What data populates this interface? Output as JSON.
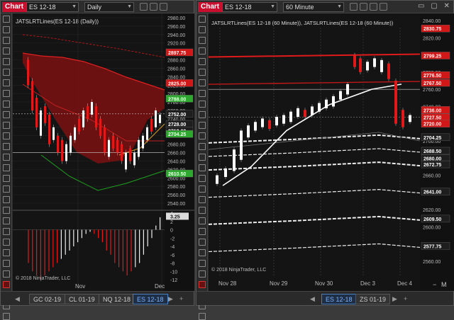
{
  "left": {
    "chart_label": "Chart",
    "instrument": "ES 12-18",
    "interval": "Daily",
    "plot_title": "JATSLRTLines(ES 12-18 (Daily))",
    "copyright": "© 2018 NinjaTrader, LLC",
    "price_ticks": [
      "2980.00",
      "2960.00",
      "2940.00",
      "2920.00",
      "2900.00",
      "2880.00",
      "2860.00",
      "2840.00",
      "2820.00",
      "2800.00",
      "2780.00",
      "2760.00",
      "2740.00",
      "2720.00",
      "2700.00",
      "2680.00",
      "2660.00",
      "2640.00",
      "2620.00",
      "2600.00",
      "2580.00",
      "2560.00",
      "2540.00"
    ],
    "price_badges": [
      {
        "text": "2897.75",
        "color": "#d01818"
      },
      {
        "text": "2825.00",
        "color": "#d01818"
      },
      {
        "text": "2788.00",
        "color": "#2ea82e"
      },
      {
        "text": "2752.00",
        "color": "#1e1e1e"
      },
      {
        "text": "2728.00",
        "color": "#1e1e1e"
      },
      {
        "text": "2712.00",
        "color": "#1e1e1e"
      },
      {
        "text": "2704.25",
        "color": "#2ea82e"
      },
      {
        "text": "2610.50",
        "color": "#2ea82e"
      }
    ],
    "osc_badge": "3.25",
    "osc_ticks": [
      "4",
      "2",
      "0",
      "-2",
      "-4",
      "-6",
      "-8",
      "-10",
      "-12"
    ],
    "x_labels": [
      "Nov",
      "Dec"
    ],
    "tabs": [
      "GC 02-19",
      "CL 01-19",
      "NQ 12-18",
      "ES 12-18"
    ],
    "active_tab": "ES 12-18"
  },
  "right": {
    "chart_label": "Chart",
    "instrument": "ES 12-18",
    "interval": "60 Minute",
    "plot_title": "JATSLRTLines(ES 12-18 (60 Minute)), JATSLRTLines(ES 12-18 (60 Minute))",
    "copyright": "© 2018 NinjaTrader, LLC",
    "price_ticks": [
      "2840.00",
      "2820.00",
      "2800.00",
      "2780.00",
      "2760.00",
      "2740.00",
      "2720.00",
      "2700.00",
      "2680.00",
      "2660.00",
      "2640.00",
      "2620.00",
      "2600.00",
      "2580.00",
      "2560.00"
    ],
    "price_badges": [
      {
        "text": "2830.75",
        "color": "#d01818"
      },
      {
        "text": "2799.25",
        "color": "#d01818"
      },
      {
        "text": "2776.50",
        "color": "#d01818"
      },
      {
        "text": "2767.50",
        "color": "#d01818"
      },
      {
        "text": "2736.00",
        "color": "#d01818"
      },
      {
        "text": "2727.50",
        "color": "#d01818"
      },
      {
        "text": "2720.00",
        "color": "#d01818"
      },
      {
        "text": "2704.25",
        "color": "#1e1e1e"
      },
      {
        "text": "2688.50",
        "color": "#1e1e1e"
      },
      {
        "text": "2680.00",
        "color": "#1e1e1e"
      },
      {
        "text": "2672.75",
        "color": "#1e1e1e"
      },
      {
        "text": "2641.00",
        "color": "#1e1e1e"
      },
      {
        "text": "2609.50",
        "color": "#1e1e1e"
      },
      {
        "text": "2577.75",
        "color": "#1e1e1e"
      }
    ],
    "x_labels": [
      "Nov 28",
      "Nov 29",
      "Nov 30",
      "Dec 3",
      "Dec 4"
    ],
    "tabs": [
      "ES 12-18",
      "ZS 01-19"
    ],
    "active_tab": "ES 12-18",
    "zoom_minus": "−",
    "zoom_m": "M"
  }
}
